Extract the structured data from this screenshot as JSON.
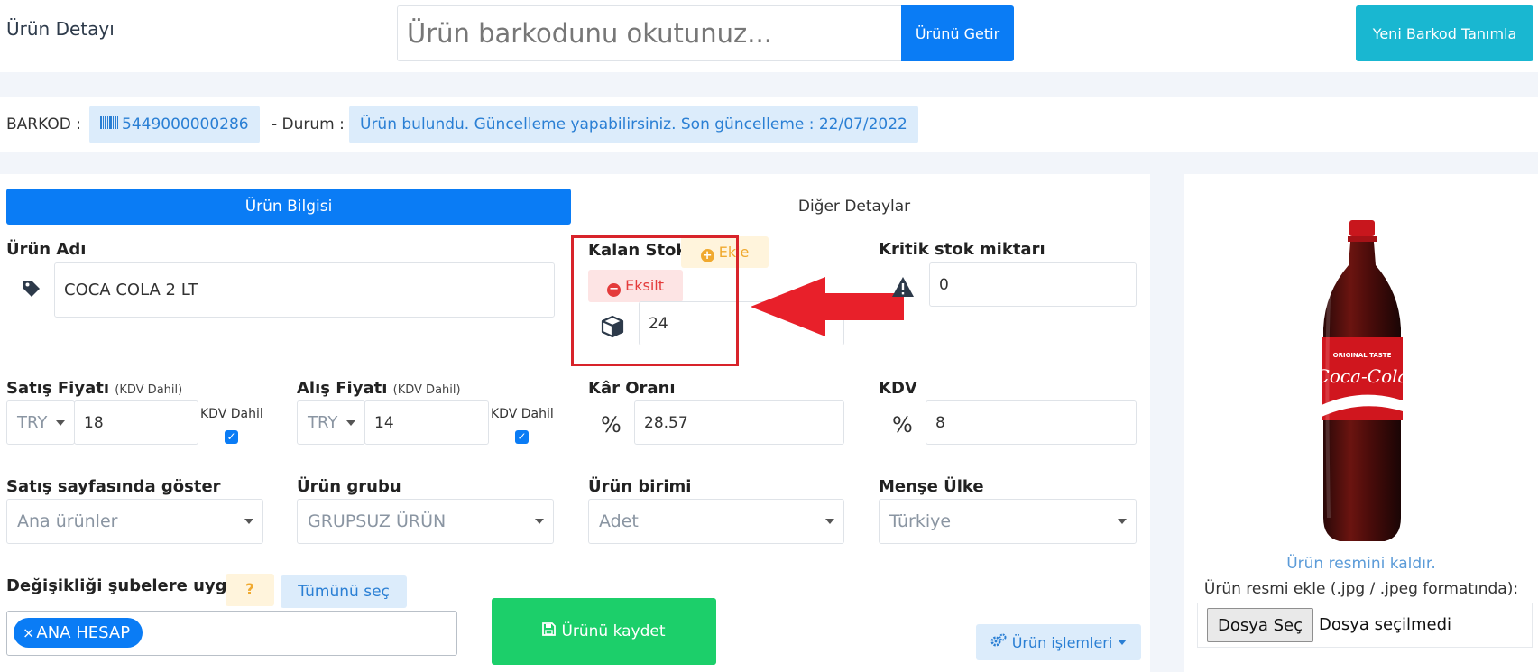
{
  "header": {
    "title": "Ürün Detayı",
    "barcode_placeholder": "Ürün barkodunu okutunuz...",
    "fetch_button": "Ürünü Getir",
    "new_barcode_button": "Yeni Barkod Tanımla"
  },
  "status": {
    "barcode_label": "BARKOD :",
    "barcode_value": "5449000000286",
    "state_label": "- Durum :",
    "state_message": "Ürün bulundu. Güncelleme yapabilirsiniz. Son güncelleme : 22/07/2022"
  },
  "tabs": [
    {
      "label": "Ürün Bilgisi",
      "active": true
    },
    {
      "label": "Diğer Detaylar",
      "active": false
    }
  ],
  "form": {
    "product_name": {
      "label": "Ürün Adı",
      "value": "COCA COLA 2 LT"
    },
    "remaining_stock": {
      "label": "Kalan Stok",
      "add_button": "Ekle",
      "decrease_button": "Eksilt",
      "value": "24"
    },
    "critical_stock": {
      "label": "Kritik stok miktarı",
      "value": "0"
    },
    "sale_price": {
      "label": "Satış Fiyatı",
      "sublabel": "(KDV Dahil)",
      "currency": "TRY",
      "value": "18",
      "vat_included_label": "KDV Dahil",
      "vat_included": true
    },
    "purchase_price": {
      "label": "Alış Fiyatı",
      "sublabel": "(KDV Dahil)",
      "currency": "TRY",
      "value": "14",
      "vat_included_label": "KDV Dahil",
      "vat_included": true
    },
    "profit_rate": {
      "label": "Kâr Oranı",
      "symbol": "%",
      "value": "28.57"
    },
    "vat": {
      "label": "KDV",
      "symbol": "%",
      "value": "8"
    },
    "show_on_sales_page": {
      "label": "Satış sayfasında göster",
      "selected": "Ana ürünler"
    },
    "product_group": {
      "label": "Ürün grubu",
      "selected": "GRUPSUZ ÜRÜN"
    },
    "product_unit": {
      "label": "Ürün birimi",
      "selected": "Adet"
    },
    "origin_country": {
      "label": "Menşe Ülke",
      "selected": "Türkiye"
    },
    "apply_to_branches": {
      "label": "Değişikliği şubelere uygula",
      "help_button": "?",
      "select_all_button": "Tümünü seç",
      "chips": [
        "ANA HESAP"
      ]
    }
  },
  "actions": {
    "save_button": "Ürünü kaydet",
    "operations_button": "Ürün işlemleri"
  },
  "image_panel": {
    "bottle_brand": "Coca-Cola",
    "bottle_tagline": "ORIGINAL TASTE",
    "remove_link": "Ürün resmini kaldır.",
    "add_label": "Ürün resmi ekle (.jpg / .jpeg formatında):",
    "file_button": "Dosya Seç",
    "file_status": "Dosya seçilmedi"
  },
  "colors": {
    "primary": "#0a7cf5",
    "info": "#19b7d1",
    "success": "#1ccf6a",
    "warning": "#f0a92f",
    "danger": "#e43b3b",
    "annotation_red": "#d8232a"
  }
}
